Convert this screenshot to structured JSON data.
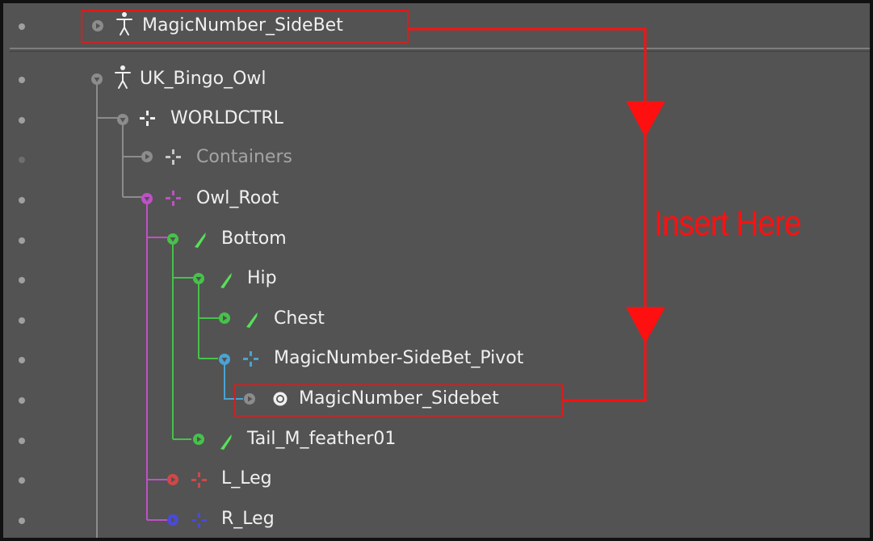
{
  "outliner": {
    "rows": [
      {
        "label": "MagicNumber_SideBet",
        "icon": "figure-icon",
        "visible": true
      },
      {
        "label": "UK_Bingo_Owl",
        "icon": "figure-icon",
        "visible": true
      },
      {
        "label": "WORLDCTRL",
        "icon": "crosshair-icon",
        "visible": true
      },
      {
        "label": "Containers",
        "icon": "crosshair-icon",
        "visible": false
      },
      {
        "label": "Owl_Root",
        "icon": "crosshair-icon",
        "visible": true
      },
      {
        "label": "Bottom",
        "icon": "bone-icon",
        "visible": true
      },
      {
        "label": "Hip",
        "icon": "bone-icon",
        "visible": true
      },
      {
        "label": "Chest",
        "icon": "bone-icon",
        "visible": true
      },
      {
        "label": "MagicNumber-SideBet_Pivot",
        "icon": "crosshair-icon",
        "visible": true
      },
      {
        "label": "MagicNumber_Sidebet",
        "icon": "target-icon",
        "visible": true
      },
      {
        "label": "Tail_M_feather01",
        "icon": "bone-icon",
        "visible": true
      },
      {
        "label": "L_Leg",
        "icon": "crosshair-icon",
        "visible": true
      },
      {
        "label": "R_Leg",
        "icon": "crosshair-icon",
        "visible": true
      }
    ]
  },
  "annotation": {
    "text": "Insert Here",
    "color": "#ff1010"
  },
  "colors": {
    "panel": "#535353",
    "line_gray": "#8c8c8c",
    "purple": "#c050c8",
    "green": "#46c24a",
    "blue": "#4aa3d2",
    "red": "#d04848",
    "navy": "#4a4ad8"
  }
}
